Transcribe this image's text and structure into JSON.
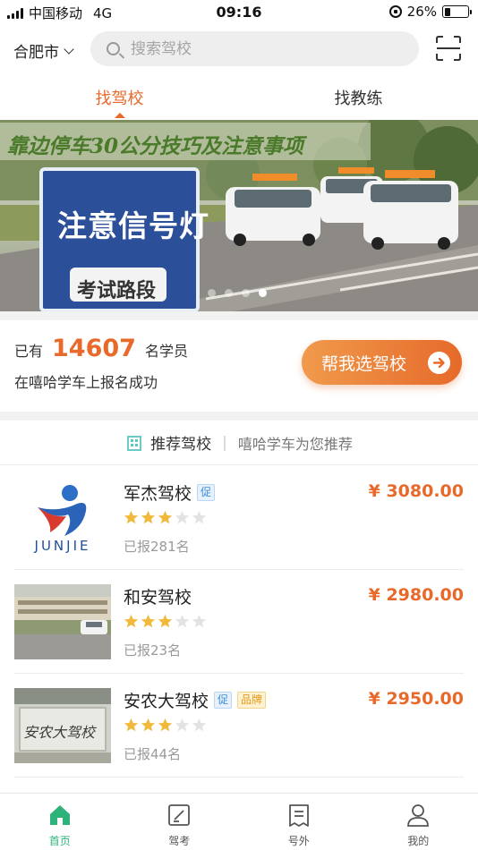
{
  "status_bar": {
    "carrier": "中国移动",
    "network": "4G",
    "time": "09:16",
    "battery": "26%"
  },
  "header": {
    "city": "合肥市",
    "search_placeholder": "搜索驾校"
  },
  "tabs": [
    {
      "label": "找驾校",
      "active": true
    },
    {
      "label": "找教练",
      "active": false
    }
  ],
  "banner": {
    "caption": "靠边停车30公分技巧及注意事项",
    "sign_text": "注意信号灯",
    "sign_subtext": "考试路段",
    "slide_count": 4,
    "active_slide": 4
  },
  "stats": {
    "prefix": "已有",
    "count": "14607",
    "suffix": "名学员",
    "line2": "在嘻哈学车上报名成功",
    "cta_label": "帮我选驾校"
  },
  "recommend": {
    "title": "推荐驾校",
    "subtitle": "嘻哈学车为您推荐"
  },
  "schools": [
    {
      "name": "军杰驾校",
      "logo_text": "JUNJIE",
      "badges": [
        "促"
      ],
      "rating": 3,
      "max_rating": 5,
      "enrolled": "已报281名",
      "price": "¥ 3080.00"
    },
    {
      "name": "和安驾校",
      "badges": [],
      "rating": 3,
      "max_rating": 5,
      "enrolled": "已报23名",
      "price": "¥ 2980.00"
    },
    {
      "name": "安农大驾校",
      "photo_text": "安农大驾校",
      "badges": [
        "促",
        "品牌"
      ],
      "rating": 3,
      "max_rating": 5,
      "enrolled": "已报44名",
      "price": "¥ 2950.00"
    }
  ],
  "bottom_nav": [
    {
      "label": "首页",
      "icon": "home-icon",
      "active": true
    },
    {
      "label": "驾考",
      "icon": "exam-icon",
      "active": false
    },
    {
      "label": "号外",
      "icon": "news-icon",
      "active": false
    },
    {
      "label": "我的",
      "icon": "profile-icon",
      "active": false
    }
  ],
  "colors": {
    "accent": "#e8692a",
    "nav_active": "#2db37a",
    "star": "#f0b93a",
    "star_empty": "#e3e3e3"
  }
}
